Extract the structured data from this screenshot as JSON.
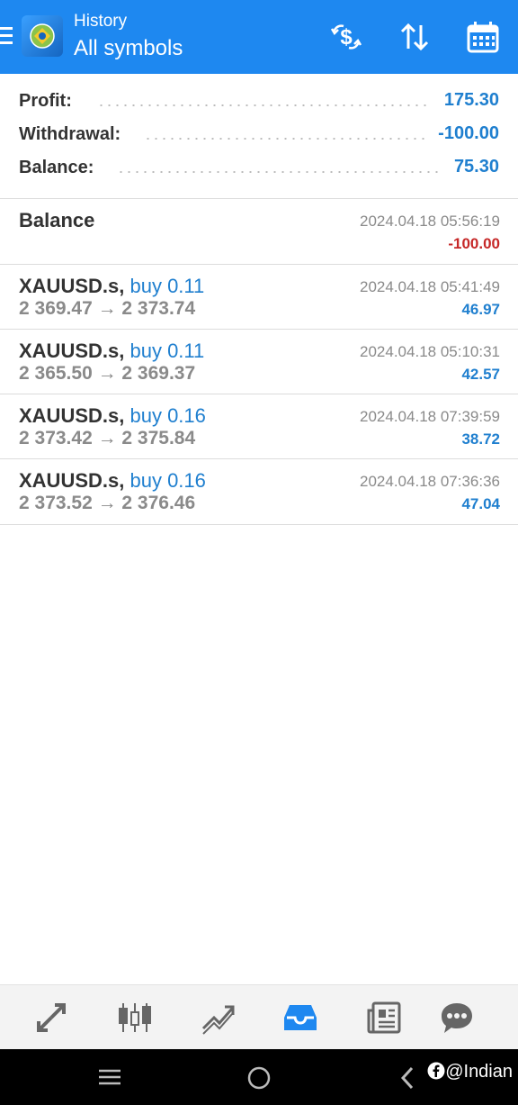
{
  "header": {
    "subtitle": "History",
    "title": "All symbols",
    "icons": [
      "menu-icon",
      "app-logo",
      "deposit-withdraw-icon",
      "sort-icon",
      "calendar-icon"
    ],
    "bg_color": "#1e88f0"
  },
  "summary": {
    "profit_label": "Profit:",
    "profit_value": "175.30",
    "withdrawal_label": "Withdrawal:",
    "withdrawal_value": "-100.00",
    "balance_label": "Balance:",
    "balance_value": "75.30"
  },
  "deals": [
    {
      "title": "Balance",
      "time": "2024.04.18 05:56:19",
      "value": "-100.00",
      "value_color": "#c62828"
    },
    {
      "symbol": "XAUUSD.s,",
      "side": "buy 0.11",
      "prices": "2 369.47 → 2 373.74",
      "time": "2024.04.18 05:41:49",
      "value": "46.97"
    },
    {
      "symbol": "XAUUSD.s,",
      "side": "buy 0.11",
      "prices": "2 365.50 → 2 369.37",
      "time": "2024.04.18 05:10:31",
      "value": "42.57"
    },
    {
      "symbol": "XAUUSD.s,",
      "side": "buy 0.16",
      "prices": "2 373.42 → 2 375.84",
      "time": "2024.04.18 07:39:59",
      "value": "38.72"
    },
    {
      "symbol": "XAUUSD.s,",
      "side": "buy 0.16",
      "prices": "2 373.52 → 2 376.46",
      "time": "2024.04.18 07:36:36",
      "value": "47.04"
    }
  ],
  "bottom_nav": {
    "items": [
      "quotes-icon",
      "chart-icon",
      "trade-icon",
      "history-icon",
      "news-icon",
      "chat-icon"
    ],
    "active": "history-icon"
  },
  "system_bar": {
    "icons": [
      "recent-apps-icon",
      "home-icon",
      "back-icon"
    ],
    "watermark": "@Indian"
  },
  "colors": {
    "positive": "#1f7fcf",
    "negative": "#c62828",
    "accent": "#1e88f0"
  }
}
